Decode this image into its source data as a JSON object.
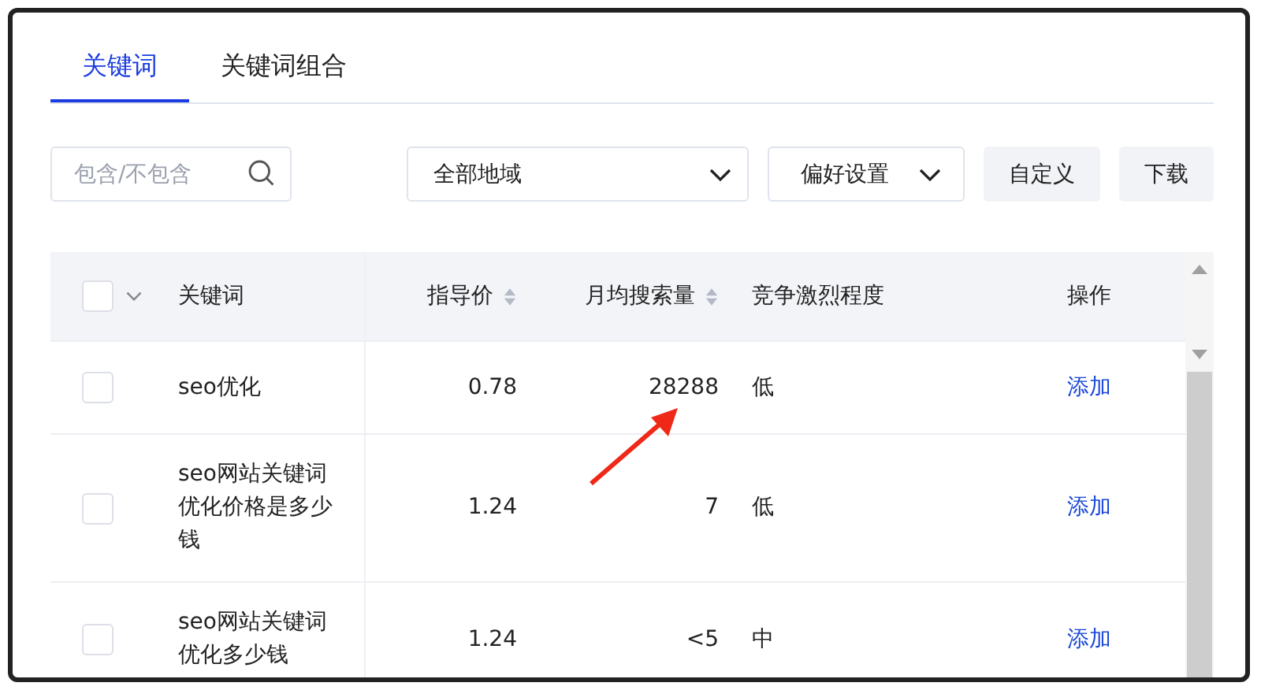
{
  "tabs": [
    {
      "label": "关键词",
      "selected": true
    },
    {
      "label": "关键词组合",
      "selected": false
    }
  ],
  "search": {
    "placeholder": "包含/不包含"
  },
  "region_select": {
    "value": "全部地域"
  },
  "preference_dropdown": {
    "label": "偏好设置"
  },
  "buttons": [
    "自定义",
    "下载"
  ],
  "table": {
    "select_all": {
      "checked": false
    },
    "columns": [
      {
        "label": "关键词",
        "sortable": false
      },
      {
        "label": "指导价",
        "sortable": true
      },
      {
        "label": "月均搜索量",
        "sortable": true
      },
      {
        "label": "竞争激烈程度",
        "sortable": false
      },
      {
        "label": "操作",
        "sortable": false
      }
    ],
    "rows": [
      {
        "checked": false,
        "cells": [
          "seo优化",
          "0.78",
          "28288",
          "低"
        ],
        "action": "添加"
      },
      {
        "checked": false,
        "cells": [
          "seo网站关键词优化价格是多少钱",
          "1.24",
          "7",
          "低"
        ],
        "action": "添加"
      },
      {
        "checked": false,
        "cells": [
          "seo网站关键词优化多少钱",
          "1.24",
          "<5",
          "中"
        ],
        "action": "添加"
      }
    ]
  }
}
